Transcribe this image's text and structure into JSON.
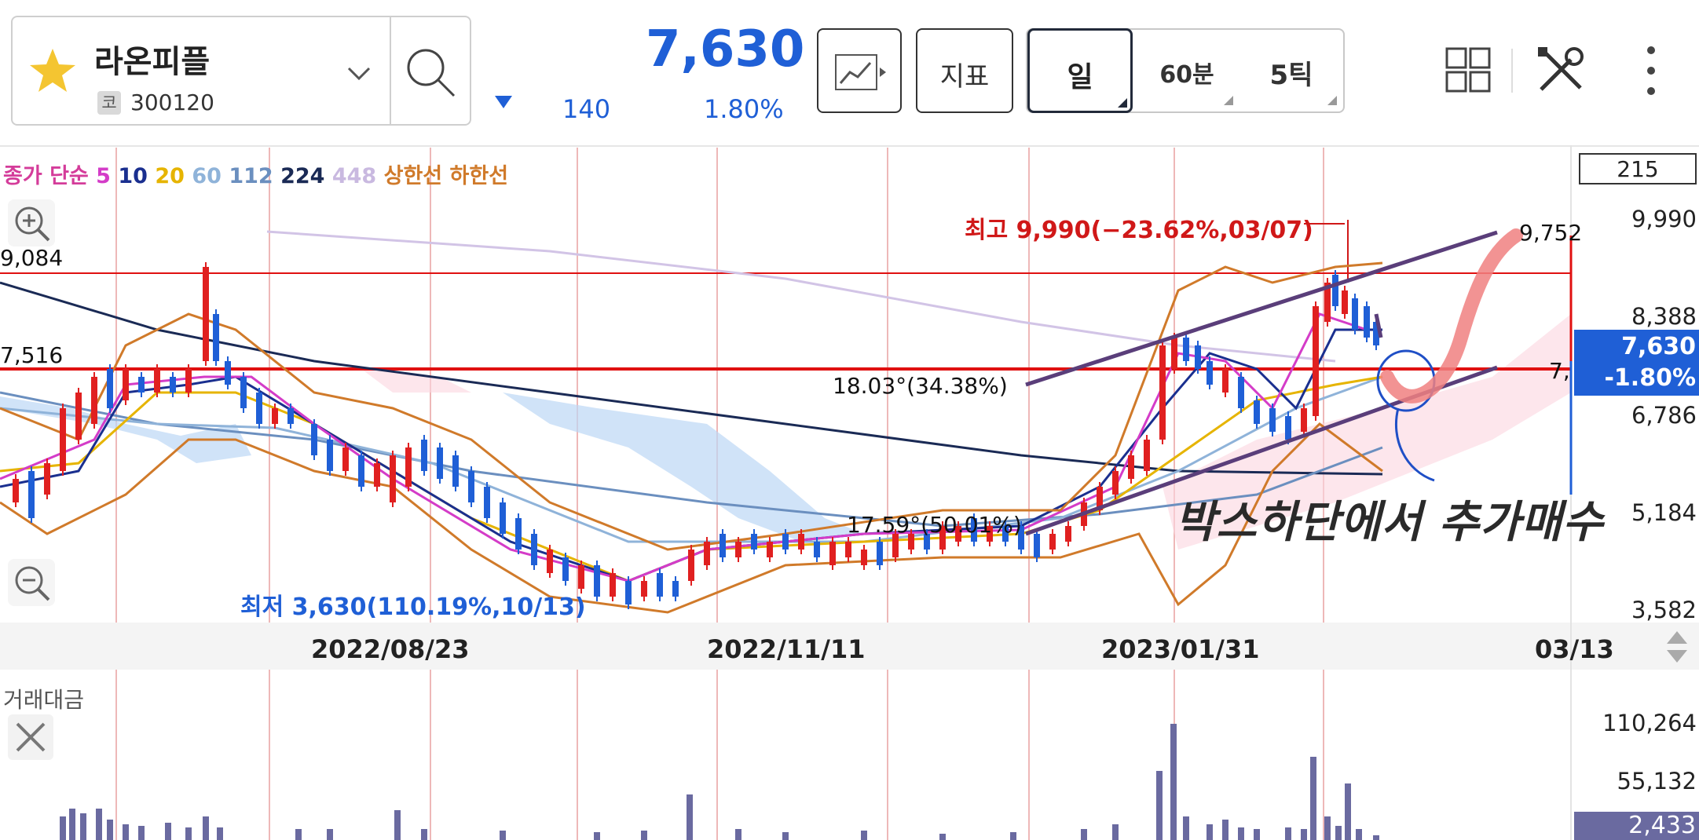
{
  "header": {
    "stock_name": "라온피플",
    "code_badge": "코",
    "stock_code": "300120",
    "price": "7,630",
    "change_value": "140",
    "change_pct": "1.80%",
    "indicator_label": "지표",
    "period_day": "일",
    "period_60min": "60분",
    "period_5tick": "5틱"
  },
  "legend": {
    "prefix": "종가 단순",
    "ma": [
      {
        "label": "5",
        "color": "#d43cc8"
      },
      {
        "label": "10",
        "color": "#1a2f8f"
      },
      {
        "label": "20",
        "color": "#e6b400"
      },
      {
        "label": "60",
        "color": "#8fb3d9"
      },
      {
        "label": "112",
        "color": "#6b8fbf"
      },
      {
        "label": "224",
        "color": "#1a2a55"
      },
      {
        "label": "448",
        "color": "#c9b9e0"
      }
    ],
    "upper": "상한선",
    "lower": "하한선"
  },
  "side_box_value": "215",
  "price_axis": [
    "9,990",
    "8,388",
    "6,786",
    "5,184",
    "3,582"
  ],
  "price_tag": {
    "price": "7,630",
    "pct": "-1.80%"
  },
  "left_labels": {
    "top": "9,084",
    "mid": "7,516"
  },
  "dates": [
    "2022/08/23",
    "2022/11/11",
    "2023/01/31",
    "03/13"
  ],
  "annotations": {
    "high": "최고 9,990(−23.62%,03/07)",
    "low": "최저 3,630(110.19%,10/13)",
    "angle1": "18.03°(34.38%)",
    "angle2": "17.59°(50.01%)",
    "right_top": "9,752",
    "right_mid": "7,",
    "handwriting": "박스하단에서 추가매수"
  },
  "volume": {
    "title": "거래대금",
    "axis": [
      "110,264",
      "55,132"
    ],
    "last": "2,433"
  },
  "colors": {
    "up": "#e02020",
    "down": "#1f5fd6",
    "accent": "#1f5fd6",
    "hline": "#e01010"
  }
}
